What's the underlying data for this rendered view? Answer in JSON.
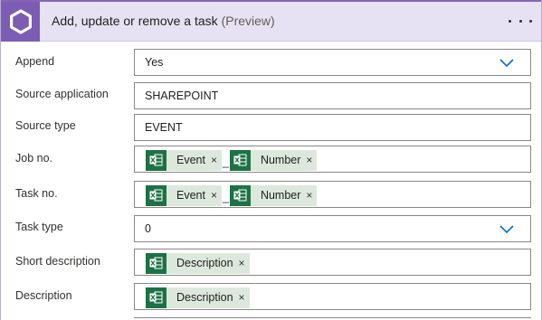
{
  "header": {
    "title": "Add, update or remove a task",
    "badge": "(Preview)",
    "more_icon": "more-ellipsis-icon",
    "logo_icon": "connector-logo-icon",
    "colors": {
      "header_bg": "#e7e2f3",
      "logo_bg": "#7d5cb3",
      "excel_green": "#1e7145",
      "token_bg": "#dde8dc"
    }
  },
  "fields": {
    "append": {
      "label": "Append",
      "value": "Yes"
    },
    "source_application": {
      "label": "Source application",
      "value": "SHAREPOINT"
    },
    "source_type": {
      "label": "Source type",
      "value": "EVENT"
    },
    "job_no": {
      "label": "Job no.",
      "tokens": [
        "Event",
        "Number"
      ],
      "separator": "_"
    },
    "task_no": {
      "label": "Task no.",
      "tokens": [
        "Event",
        "Number"
      ],
      "separator": "_"
    },
    "task_type": {
      "label": "Task type",
      "value": "0"
    },
    "short_description": {
      "label": "Short description",
      "tokens": [
        "Description"
      ]
    },
    "description": {
      "label": "Description",
      "tokens": [
        "Description"
      ]
    }
  },
  "token_remove_glyph": "×",
  "token_icon": "excel-icon"
}
